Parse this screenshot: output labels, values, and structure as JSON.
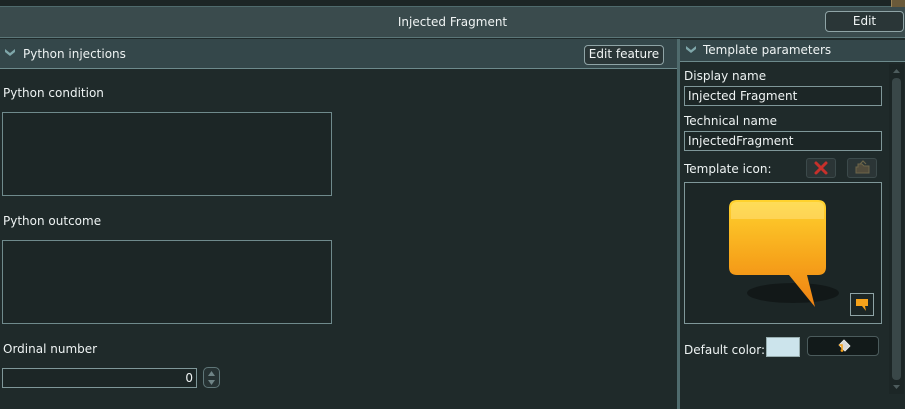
{
  "window": {
    "title": "Injected Fragment",
    "edit_label": "Edit"
  },
  "python_injections": {
    "section_title": "Python injections",
    "edit_feature_label": "Edit feature",
    "condition_label": "Python condition",
    "condition_value": "",
    "outcome_label": "Python outcome",
    "outcome_value": "",
    "ordinal_label": "Ordinal number",
    "ordinal_value": "0"
  },
  "template_parameters": {
    "section_title": "Template parameters",
    "display_name_label": "Display name",
    "display_name_value": "Injected Fragment",
    "technical_name_label": "Technical name",
    "technical_name_value": "InjectedFragment",
    "template_icon_label": "Template icon:",
    "default_color_label": "Default color:",
    "default_color_value": "#cce4ec"
  },
  "icons": {
    "collapse": "chevron-down-icon",
    "clear_icon": "close-icon",
    "load_icon": "folder-open-icon",
    "template_icon": "speech-bubble-icon",
    "paint": "paint-bucket-icon",
    "spin_up": "up-arrow-icon",
    "spin_down": "down-arrow-icon"
  },
  "colors": {
    "accent_orange": "#f6a21a",
    "delete_red": "#c7302b",
    "panel_bg": "#1f2a2a",
    "header_bg": "#3a4b4d"
  }
}
